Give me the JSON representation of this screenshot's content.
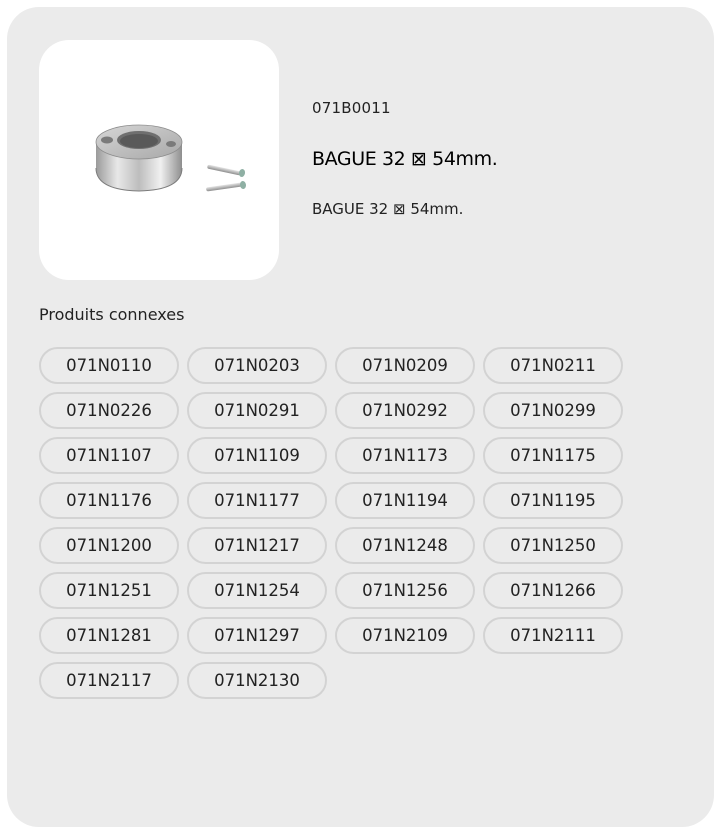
{
  "product": {
    "sku": "071B0011",
    "title": "BAGUE 32 ⊠ 54mm.",
    "description": "BAGUE 32 ⊠ 54mm."
  },
  "related": {
    "label": "Produits connexes",
    "items": [
      "071N0110",
      "071N0203",
      "071N0209",
      "071N0211",
      "071N0226",
      "071N0291",
      "071N0292",
      "071N0299",
      "071N1107",
      "071N1109",
      "071N1173",
      "071N1175",
      "071N1176",
      "071N1177",
      "071N1194",
      "071N1195",
      "071N1200",
      "071N1217",
      "071N1248",
      "071N1250",
      "071N1251",
      "071N1254",
      "071N1256",
      "071N1266",
      "071N1281",
      "071N1297",
      "071N2109",
      "071N2111",
      "071N2117",
      "071N2130"
    ]
  }
}
